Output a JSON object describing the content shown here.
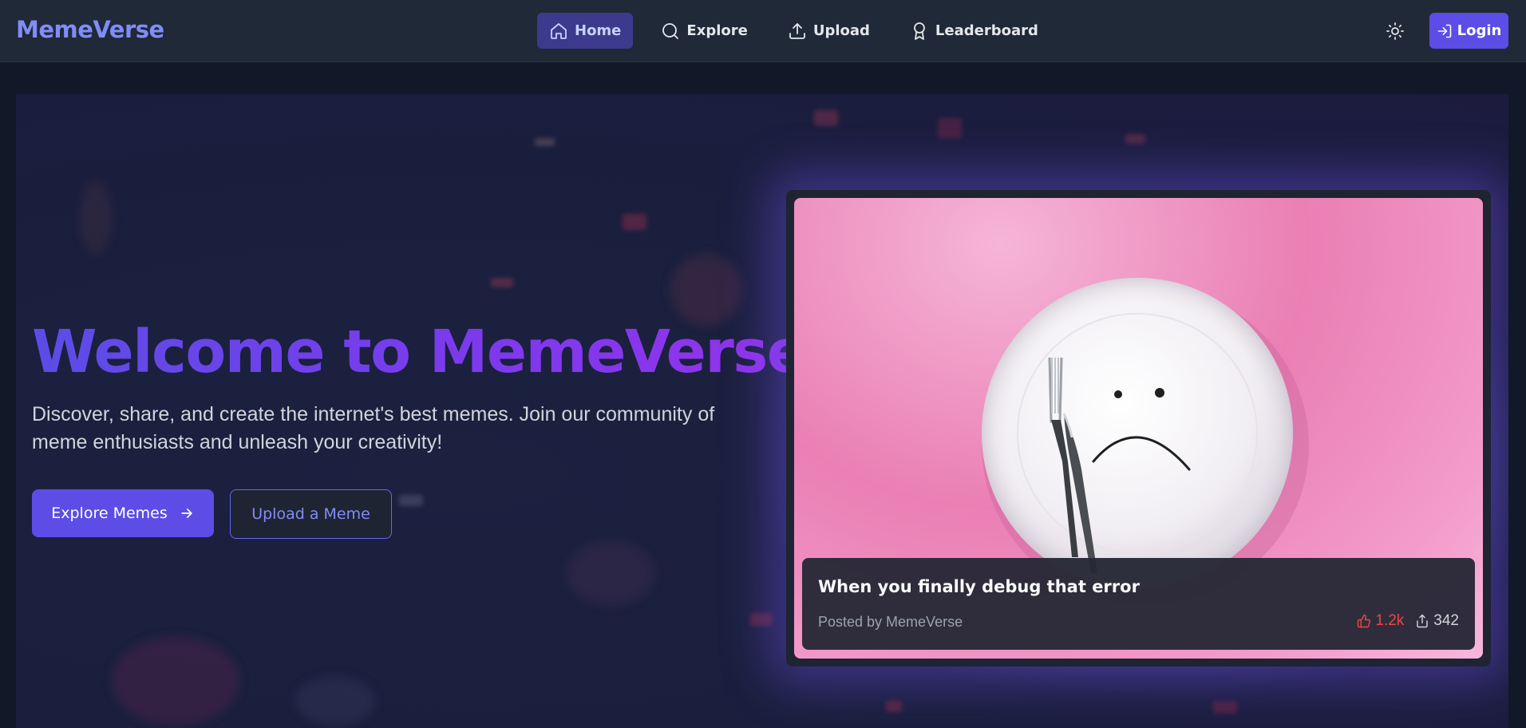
{
  "navbar": {
    "brand": "MemeVerse",
    "links": [
      {
        "label": "Home",
        "icon": "home-icon",
        "active": true
      },
      {
        "label": "Explore",
        "icon": "search-icon",
        "active": false
      },
      {
        "label": "Upload",
        "icon": "upload-icon",
        "active": false
      },
      {
        "label": "Leaderboard",
        "icon": "award-icon",
        "active": false
      }
    ],
    "theme_toggle_icon": "sun-icon",
    "login_label": "Login",
    "login_icon": "log-in-icon"
  },
  "hero": {
    "title": "Welcome to MemeVerse",
    "subtitle": "Discover, share, and create the internet's best memes. Join our community of meme enthusiasts and unleash your creativity!",
    "primary_button": "Explore Memes",
    "primary_icon": "arrow-right-icon",
    "secondary_button": "Upload a Meme"
  },
  "featured_meme": {
    "title": "When you finally debug that error",
    "author": "Posted by MemeVerse",
    "likes": "1.2k",
    "likes_icon": "thumbs-up-icon",
    "shares": "342",
    "shares_icon": "share-icon"
  },
  "colors": {
    "accent": "#5b4de6",
    "brand_text": "#818cf8",
    "background": "#111827",
    "navbar": "#1f2937",
    "likes": "#ef4444"
  }
}
